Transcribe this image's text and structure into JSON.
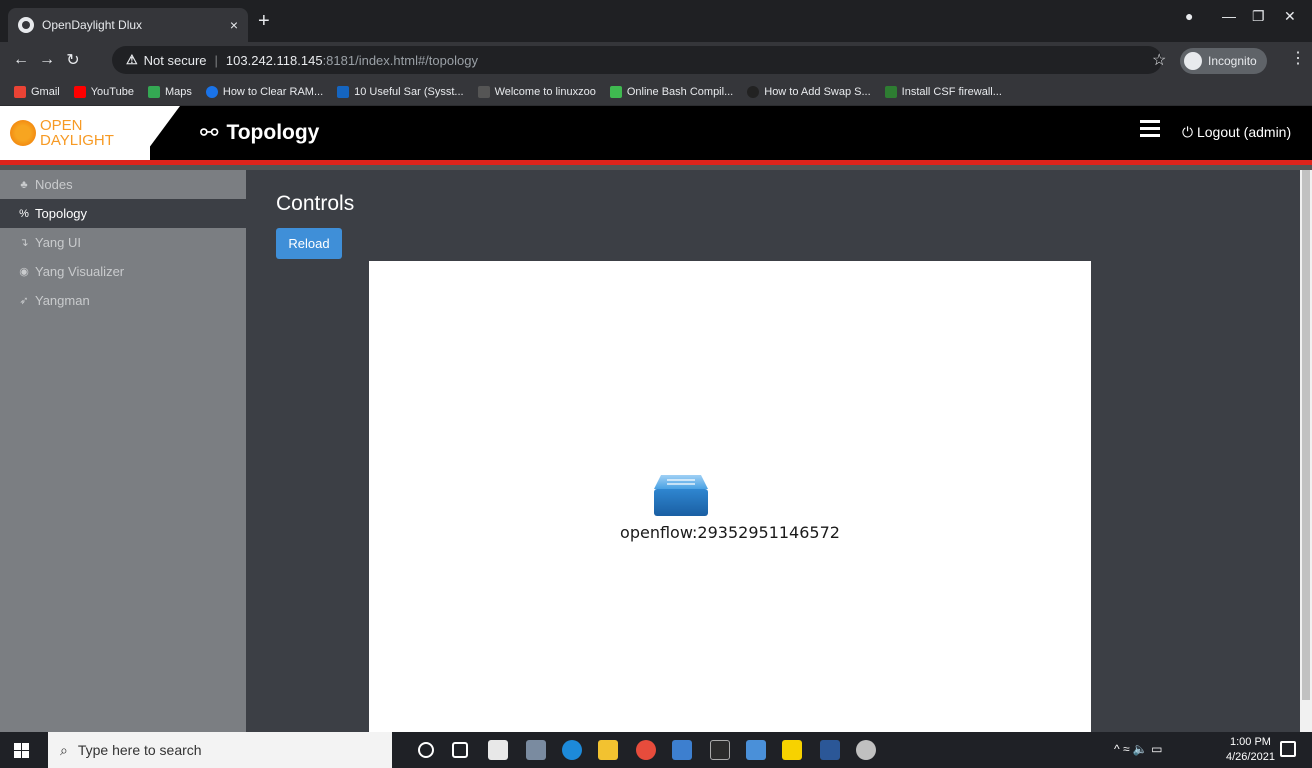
{
  "browser": {
    "tab_title": "OpenDaylight Dlux",
    "tab_close": "×",
    "new_tab": "+",
    "security_label": "Not secure",
    "url_host": "103.242.118.145",
    "url_rest": ":8181/index.html#/topology",
    "incognito_label": "Incognito",
    "bookmarks": [
      {
        "label": "Gmail",
        "color": "#ea4335"
      },
      {
        "label": "YouTube",
        "color": "#ff0000"
      },
      {
        "label": "Maps",
        "color": "#34a853"
      },
      {
        "label": "How to Clear RAM...",
        "color": "#1a73e8"
      },
      {
        "label": "10 Useful Sar (Sysst...",
        "color": "#1565c0"
      },
      {
        "label": "Welcome to linuxzoo",
        "color": "#555555"
      },
      {
        "label": "Online Bash Compil...",
        "color": "#3fb950"
      },
      {
        "label": "How to Add Swap S...",
        "color": "#222222"
      },
      {
        "label": "Install CSF firewall...",
        "color": "#2e7d32"
      }
    ]
  },
  "app": {
    "logo_line1": "OPEN",
    "logo_line2": "DAYLIGHT",
    "title": "Topology",
    "logout_label": "Logout (admin)",
    "accent_color": "#e0241b"
  },
  "sidebar": {
    "items": [
      {
        "label": "Nodes",
        "icon": "sitemap-icon",
        "active": false
      },
      {
        "label": "Topology",
        "icon": "topology-icon",
        "active": true
      },
      {
        "label": "Yang UI",
        "icon": "arrow-down-icon",
        "active": false
      },
      {
        "label": "Yang Visualizer",
        "icon": "eye-icon",
        "active": false
      },
      {
        "label": "Yangman",
        "icon": "rocket-icon",
        "active": false
      }
    ]
  },
  "main": {
    "controls_title": "Controls",
    "reload_label": "Reload",
    "node_label": "openflow:29352951146572"
  },
  "taskbar": {
    "search_placeholder": "Type here to search",
    "time": "1:00 PM",
    "date": "4/26/2021"
  }
}
